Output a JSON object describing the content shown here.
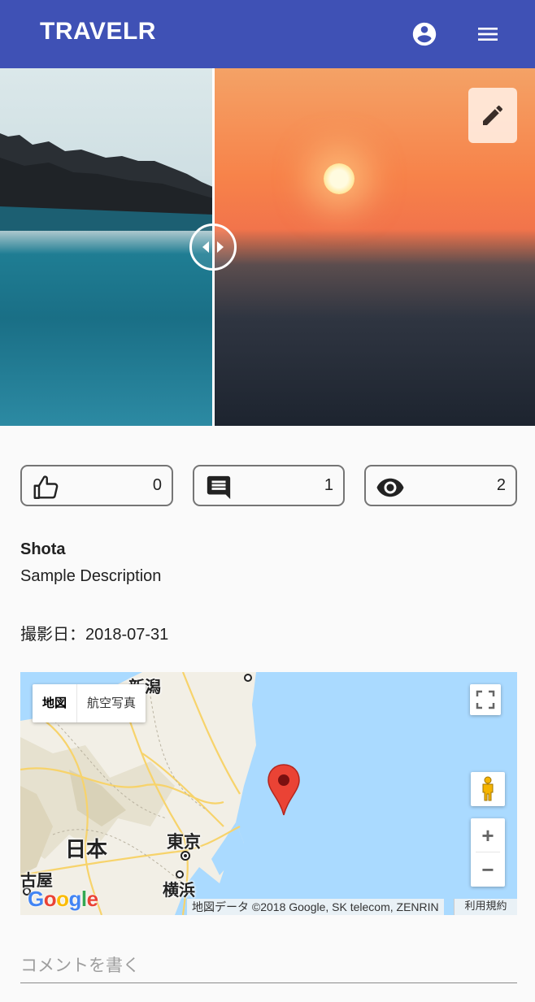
{
  "appbar": {
    "title": "TRAVELR",
    "account_icon": "account-circle-icon",
    "menu_icon": "menu-icon",
    "color": "#3f51b5"
  },
  "photo": {
    "edit_icon": "pencil-icon",
    "compare_handle_icon": "compare-arrows-icon"
  },
  "stats": {
    "likes": "0",
    "comments": "1",
    "views": "2"
  },
  "post": {
    "author": "Shota",
    "description": "Sample Description",
    "date_label": "撮影日：2018-07-31"
  },
  "map": {
    "type_map": "地図",
    "type_satellite": "航空写真",
    "labels": {
      "japan": "日本",
      "tokyo": "東京",
      "yokohama": "横浜",
      "nagoya": "古屋",
      "niigata": "新潟"
    },
    "attribution": "地図データ ©2018 Google, SK telecom, ZENRIN",
    "terms": "利用規約",
    "zoom_in": "+",
    "zoom_out": "−",
    "logo": "Google"
  },
  "comment": {
    "placeholder": "コメントを書く"
  }
}
